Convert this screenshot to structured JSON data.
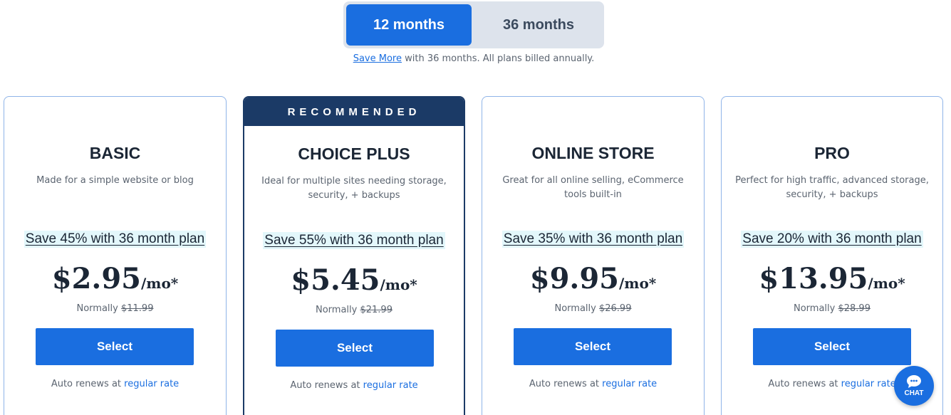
{
  "toggle": {
    "option_12": "12 months",
    "option_36": "36 months"
  },
  "save_note": {
    "link": "Save More",
    "text": " with 36 months. All plans billed annually."
  },
  "plans": [
    {
      "name": "BASIC",
      "desc": "Made for a simple website or blog",
      "save": "Save 45% with 36 month plan",
      "price": "$2.95",
      "per": "/mo*",
      "normally_label": "Normally ",
      "normally_price": "$11.99",
      "select": "Select",
      "renew_text": "Auto renews at ",
      "renew_link": "regular rate"
    },
    {
      "badge": "RECOMMENDED",
      "name": "CHOICE PLUS",
      "desc": "Ideal for multiple sites needing storage, security, + backups",
      "save": "Save 55% with 36 month plan",
      "price": "$5.45",
      "per": "/mo*",
      "normally_label": "Normally ",
      "normally_price": "$21.99",
      "select": "Select",
      "renew_text": "Auto renews at ",
      "renew_link": "regular rate"
    },
    {
      "name": "ONLINE STORE",
      "desc": "Great for all online selling, eCommerce tools built-in",
      "save": "Save 35% with 36 month plan",
      "price": "$9.95",
      "per": "/mo*",
      "normally_label": "Normally ",
      "normally_price": "$26.99",
      "select": "Select",
      "renew_text": "Auto renews at ",
      "renew_link": "regular rate"
    },
    {
      "name": "PRO",
      "desc": "Perfect for high traffic, advanced storage, security, + backups",
      "save": "Save 20% with 36 month plan",
      "price": "$13.95",
      "per": "/mo*",
      "normally_label": "Normally ",
      "normally_price": "$28.99",
      "select": "Select",
      "renew_text": "Auto renews at ",
      "renew_link": "regular rate"
    }
  ],
  "chat": {
    "label": "CHAT",
    "icon": "chat-bubble-icon"
  },
  "colors": {
    "accent": "#1a6ee0",
    "navy": "#1b3a66",
    "save_highlight": "#e3f7fb"
  }
}
